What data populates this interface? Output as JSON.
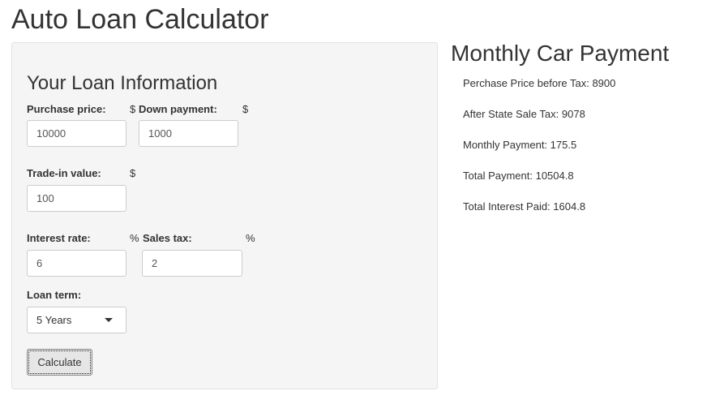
{
  "app": {
    "title": "Auto Loan Calculator"
  },
  "form": {
    "heading": "Your Loan Information",
    "purchase_price": {
      "label": "Purchase price:",
      "unit": "$",
      "value": "10000"
    },
    "down_payment": {
      "label": "Down payment:",
      "unit": "$",
      "value": "1000"
    },
    "trade_in": {
      "label": "Trade-in value:",
      "unit": "$",
      "value": "100"
    },
    "interest_rate": {
      "label": "Interest rate:",
      "unit": "%",
      "value": "6"
    },
    "sales_tax": {
      "label": "Sales tax:",
      "unit": "%",
      "value": "2"
    },
    "loan_term": {
      "label": "Loan term:",
      "selected": "5 Years"
    },
    "calculate_label": "Calculate"
  },
  "results": {
    "heading": "Monthly Car Payment",
    "lines": [
      "Perchase Price before Tax: 8900",
      "After State Sale Tax: 9078",
      "Monthly Payment: 175.5",
      "Total Payment: 10504.8",
      "Total Interest Paid: 1604.8"
    ]
  }
}
